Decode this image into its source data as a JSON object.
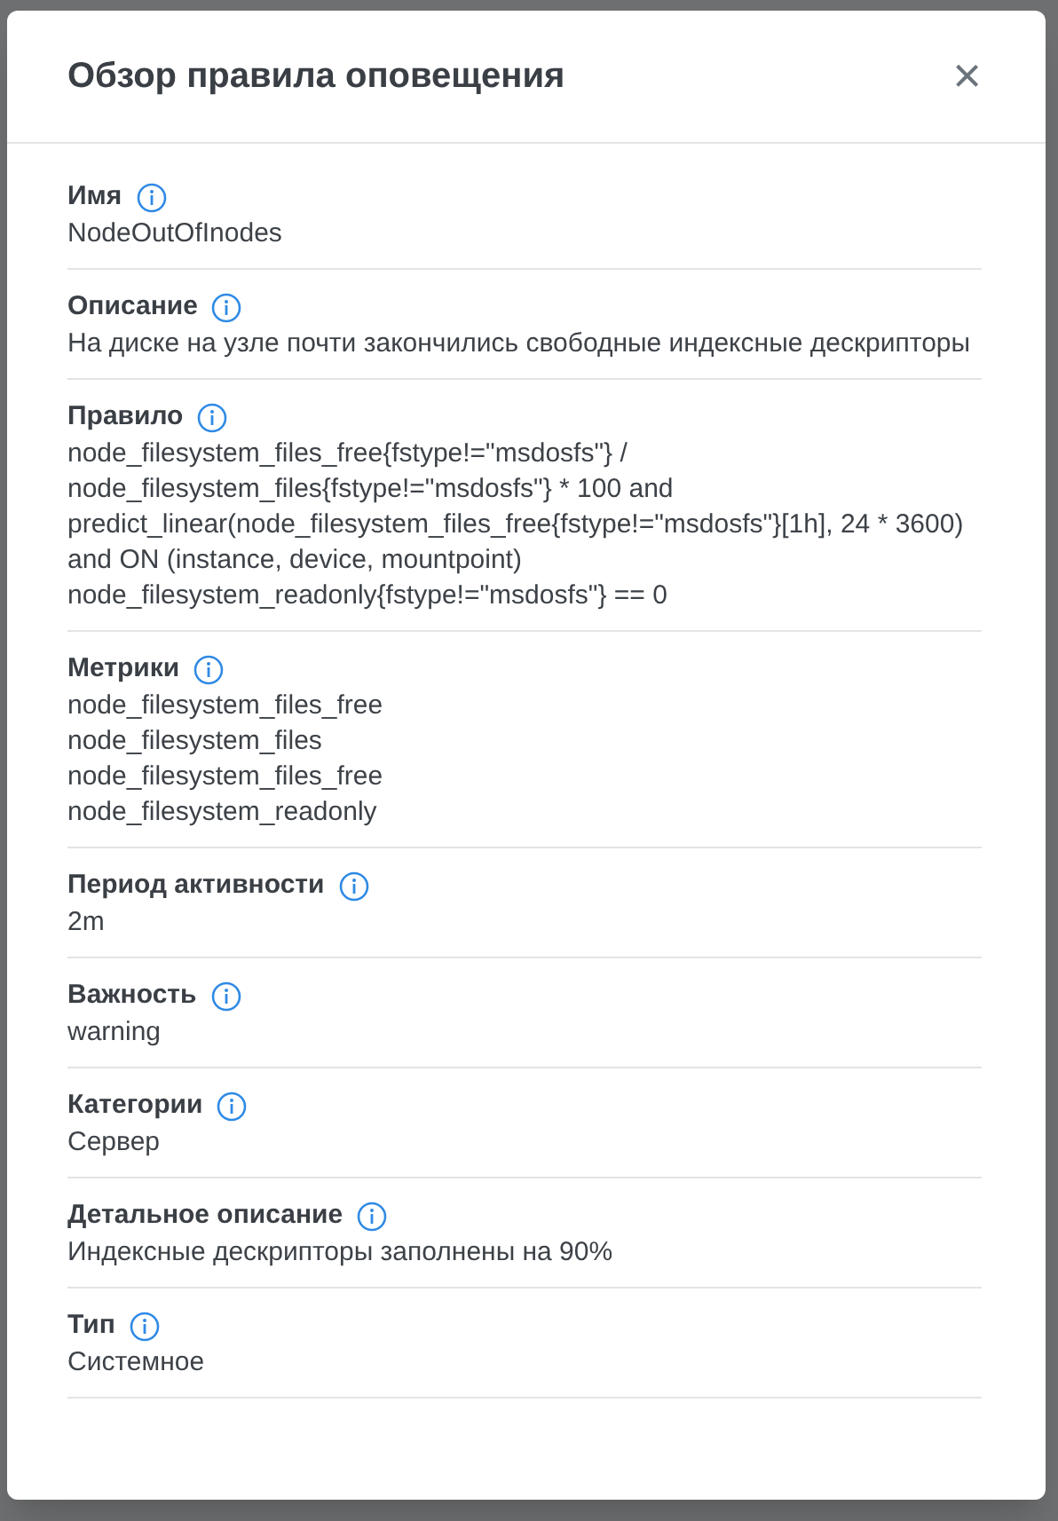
{
  "dialog": {
    "title": "Обзор правила оповещения",
    "close": "×"
  },
  "fields": [
    {
      "label": "Имя",
      "values": [
        "NodeOutOfInodes"
      ]
    },
    {
      "label": "Описание",
      "values": [
        "На диске на узле почти закончились свободные индексные дескрипторы"
      ]
    },
    {
      "label": "Правило",
      "values": [
        "node_filesystem_files_free{fstype!=\"msdosfs\"} / node_filesystem_files{fstype!=\"msdosfs\"} * 100 and predict_linear(node_filesystem_files_free{fstype!=\"msdosfs\"}[1h], 24 * 3600) and ON (instance, device, mountpoint) node_filesystem_readonly{fstype!=\"msdosfs\"} == 0"
      ]
    },
    {
      "label": "Метрики",
      "values": [
        "node_filesystem_files_free",
        "node_filesystem_files",
        "node_filesystem_files_free",
        "node_filesystem_readonly"
      ]
    },
    {
      "label": "Период активности",
      "values": [
        "2m"
      ]
    },
    {
      "label": "Важность",
      "values": [
        "warning"
      ]
    },
    {
      "label": "Категории",
      "values": [
        "Сервер"
      ]
    },
    {
      "label": "Детальное описание",
      "values": [
        "Индексные дескрипторы заполнены на 90%"
      ]
    },
    {
      "label": "Тип",
      "values": [
        "Системное"
      ]
    }
  ]
}
